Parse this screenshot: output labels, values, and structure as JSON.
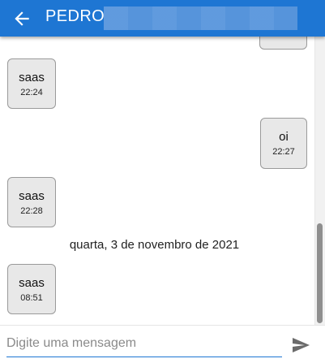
{
  "header": {
    "contact_name": "PEDRO"
  },
  "messages": [
    {
      "direction": "sent",
      "text": "",
      "time": ""
    },
    {
      "direction": "received",
      "text": "saas",
      "time": "22:24"
    },
    {
      "direction": "sent",
      "text": "oi",
      "time": "22:27"
    },
    {
      "direction": "received",
      "text": "saas",
      "time": "22:28"
    },
    {
      "date_separator": "quarta, 3 de novembro de 2021"
    },
    {
      "direction": "received",
      "text": "saas",
      "time": "08:51"
    }
  ],
  "composer": {
    "placeholder": "Digite uma mensagem"
  },
  "icons": {
    "back": "arrow-left-icon",
    "send": "send-icon"
  },
  "colors": {
    "header": "#1e76d3",
    "bubble": "#e8e8e8",
    "accent": "#1e76d3"
  }
}
